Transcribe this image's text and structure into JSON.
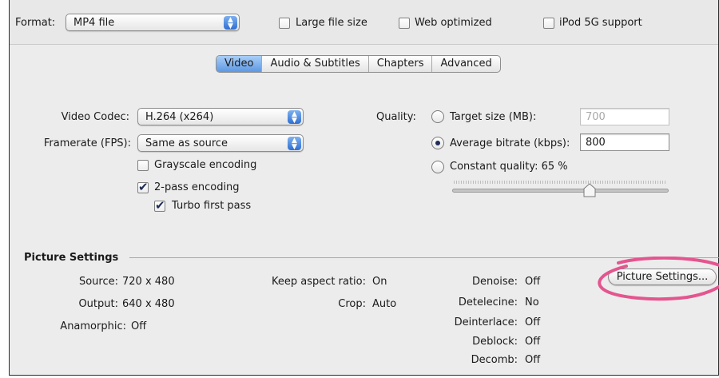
{
  "format": {
    "label": "Format:",
    "selected": "MP4 file",
    "options": [
      {
        "label": "Large file size",
        "checked": false
      },
      {
        "label": "Web optimized",
        "checked": false
      },
      {
        "label": "iPod 5G support",
        "checked": false
      }
    ]
  },
  "tabs": [
    {
      "label": "Video",
      "active": true
    },
    {
      "label": "Audio & Subtitles",
      "active": false
    },
    {
      "label": "Chapters",
      "active": false
    },
    {
      "label": "Advanced",
      "active": false
    }
  ],
  "video": {
    "codec_label": "Video Codec:",
    "codec_value": "H.264 (x264)",
    "framerate_label": "Framerate (FPS):",
    "framerate_value": "Same as source",
    "grayscale": {
      "label": "Grayscale encoding",
      "checked": false
    },
    "two_pass": {
      "label": "2-pass encoding",
      "checked": true
    },
    "turbo": {
      "label": "Turbo first pass",
      "checked": true
    }
  },
  "quality": {
    "label": "Quality:",
    "target_size": {
      "label": "Target size (MB):",
      "value": "700",
      "selected": false
    },
    "avg_bitrate": {
      "label": "Average bitrate (kbps):",
      "value": "800",
      "selected": true
    },
    "constant": {
      "label": "Constant quality: 65 %",
      "selected": false,
      "slider_level": 0.65
    }
  },
  "picture": {
    "title": "Picture Settings",
    "source_label": "Source:",
    "source_value": "720 x 480",
    "output_label": "Output:",
    "output_value": "640 x 480",
    "anamorphic_label": "Anamorphic:",
    "anamorphic_value": "Off",
    "keep_aspect_label": "Keep aspect ratio:",
    "keep_aspect_value": "On",
    "crop_label": "Crop:",
    "crop_value": "Auto",
    "denoise_label": "Denoise:",
    "denoise_value": "Off",
    "detelecine_label": "Detelecine:",
    "detelecine_value": "No",
    "deinterlace_label": "Deinterlace:",
    "deinterlace_value": "Off",
    "deblock_label": "Deblock:",
    "deblock_value": "Off",
    "decomb_label": "Decomb:",
    "decomb_value": "Off",
    "button_label": "Picture Settings..."
  },
  "colors": {
    "accent_blue": "#5d98e3",
    "annotation_pink": "#e4558f"
  }
}
